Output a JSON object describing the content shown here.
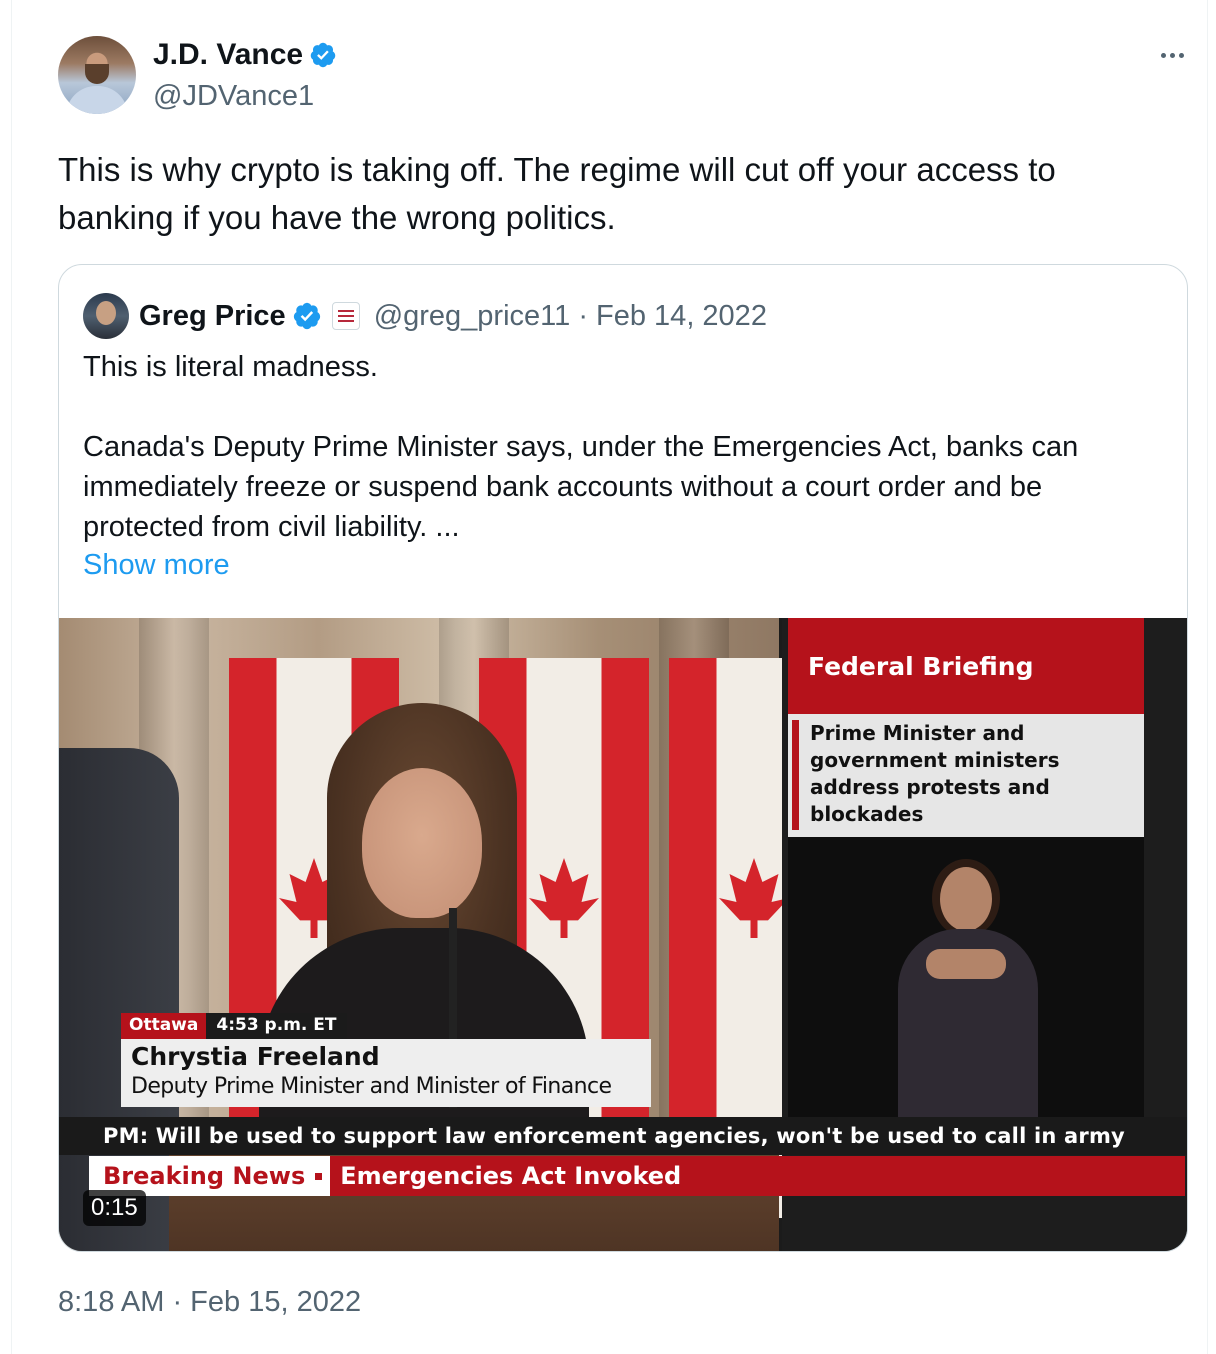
{
  "author": {
    "name": "J.D. Vance",
    "handle": "@JDVance1",
    "verified_icon": "verified-badge-icon"
  },
  "more_icon": "more-options-icon",
  "tweet": {
    "text": "This is why crypto is taking off. The regime will cut off your access to banking if you have the wrong politics.",
    "timestamp": "8:18 AM · Feb 15, 2022"
  },
  "quoted_tweet": {
    "author_name": "Greg Price",
    "handle_and_date": "@greg_price11 · Feb 14, 2022",
    "text": "This is literal madness.\n\nCanada's Deputy Prime Minister says, under the Emergencies Act, banks can immediately freeze or suspend bank accounts without a court order and be protected from civil liability. ...",
    "show_more_label": "Show more",
    "video": {
      "panel_title": "Federal Briefing",
      "panel_subtitle": "Prime Minister and\ngovernment ministers\naddress protests and\nblockades",
      "location": "Ottawa",
      "time": "4:53 p.m. ET",
      "speaker_name": "Chrystia Freeland",
      "speaker_title": "Deputy Prime Minister and Minister of Finance",
      "ticker_top": "PM: Will be used to support law enforcement agencies, won't be used to call in army",
      "breaking_label": "Breaking News",
      "breaking_headline": "Emergencies Act Invoked",
      "duration": "0:15"
    }
  },
  "colors": {
    "verified_blue": "#1d9bf0",
    "link_blue": "#1d9bf0",
    "secondary_text": "#536471",
    "news_red": "#b5121b"
  }
}
